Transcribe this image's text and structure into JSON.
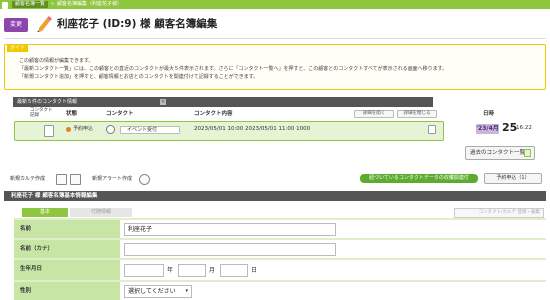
{
  "breadcrumb": {
    "item1": "顧客名簿一覧",
    "separator": "»",
    "item2": "顧客名簿編集（利座花子様）"
  },
  "header": {
    "badge": "変更",
    "title": "利座花子 (ID:9) 様 顧客名簿編集"
  },
  "guide": {
    "tag": "ガイド",
    "lines": [
      "この顧客の情報が編集できます。",
      "「最新コンタクト一覧」には、この顧客との直近のコンタクトが最大５件表示されます。さらに「コンタクト一覧へ」を押すと、この顧客とのコンタクトすべてが表示される画面へ移ります。",
      "「新規コンタクト追加」を押すと、顧客情報とお店とのコンタクトを関連付けて記録することができます。"
    ]
  },
  "contact_info": {
    "header": "最新５件のコンタクト情報",
    "close_icon": "close-icon",
    "columns": {
      "contact_note": "コンタクト\n記録",
      "status": "状態",
      "contact": "コンタクト",
      "content": "コンタクト内容",
      "date": "日時"
    },
    "detail_open": "詳細を開く",
    "detail_close": "詳細を閉じる",
    "rows": [
      {
        "status": "予約申込",
        "event": "イベント受付",
        "datetime": "2023/05/01 10:00 2023/05/01 11:00 1000",
        "badge": "'23/4月",
        "day": "25",
        "time": "16:22"
      }
    ],
    "past_button": "過去のコンタクト一覧"
  },
  "actions": {
    "new_karte": "新規カルテ作成",
    "new_alert": "新規アラート作成",
    "linked_button": "紐づいているコンタクトデータの収穫関連付",
    "reserve_button": "予約申込（1）"
  },
  "basic_info": {
    "header": "利座花子 様 顧客名簿基本情報編集",
    "tab_basic": "基本",
    "tab_other": "付随情報",
    "log_button": "コンタクト/カルテ 登録・編集",
    "fields": [
      {
        "label": "名前",
        "value": "利座花子"
      },
      {
        "label": "名前（カナ）",
        "value": ""
      },
      {
        "label": "生年月日",
        "year_unit": "年",
        "month_unit": "月",
        "day_unit": "日"
      },
      {
        "label": "性別",
        "value": "選択してください"
      }
    ]
  },
  "colors": {
    "green": "#8fc63f",
    "purple": "#8e44ad",
    "guide_border": "#f0c800",
    "dark_header": "#555555"
  }
}
